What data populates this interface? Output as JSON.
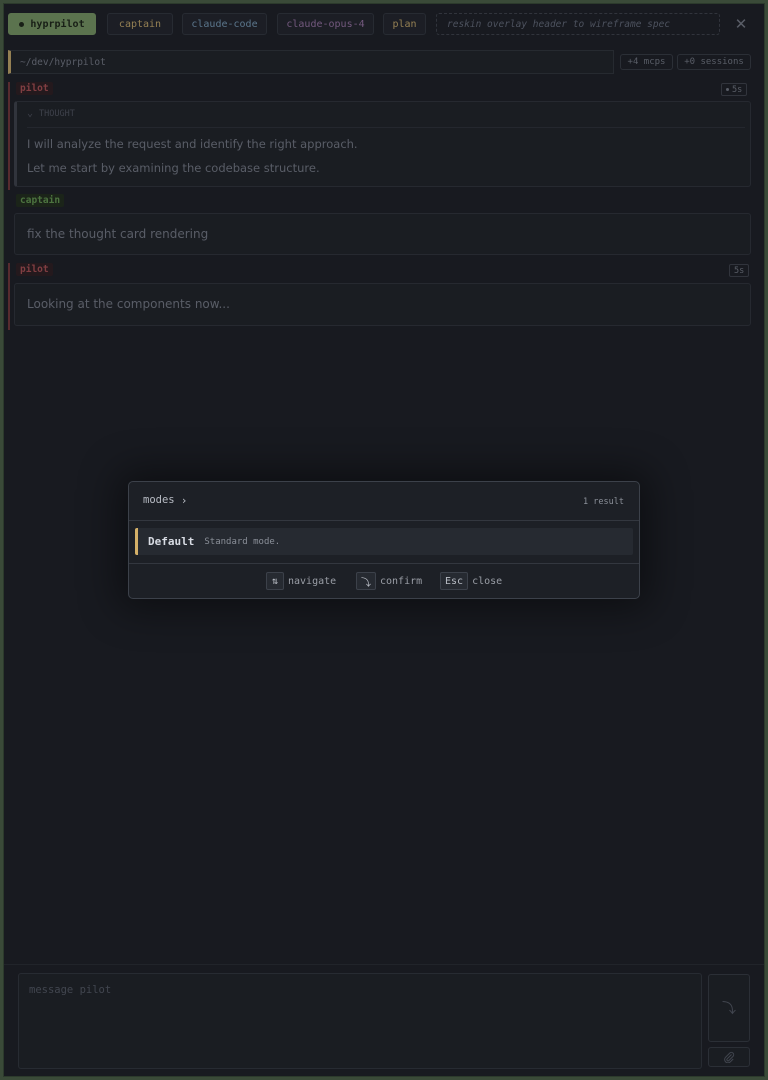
{
  "header": {
    "app_label": "hyprpilot",
    "captain_label": "captain",
    "backend_label": "claude-code",
    "model_label": "claude-opus-4",
    "mode_label": "plan",
    "task_placeholder": "reskin overlay header to wireframe spec",
    "close_glyph": "✕"
  },
  "path": {
    "cwd": "~/dev/hyprpilot",
    "mcps": "+4 mcps",
    "sessions": "+0 sessions"
  },
  "messages": [
    {
      "role": "pilot",
      "timer": "5s",
      "thought_label": "THOUGHT",
      "lines": [
        "I will analyze the request and identify the right approach.",
        "Let me start by examining the codebase structure."
      ]
    },
    {
      "role": "captain",
      "text": "fix the thought card rendering"
    },
    {
      "role": "pilot",
      "timer": "5s",
      "text": "Looking at the components now..."
    }
  ],
  "palette": {
    "title": "modes",
    "arrow": "›",
    "count": "1 result",
    "items": [
      {
        "name": "Default",
        "description": "Standard mode."
      }
    ],
    "hints": [
      {
        "key": "⇅",
        "label": "navigate"
      },
      {
        "key": "⤵",
        "label": "confirm"
      },
      {
        "key": "Esc",
        "label": "close"
      }
    ]
  },
  "composer": {
    "placeholder": "message pilot",
    "send_glyph": "⤵"
  },
  "colors": {
    "app_accent": "#6d8a5c",
    "captain_accent": "#b39a62",
    "pilot_accent": "#9c4a4e",
    "selection_accent": "#d4b068"
  }
}
